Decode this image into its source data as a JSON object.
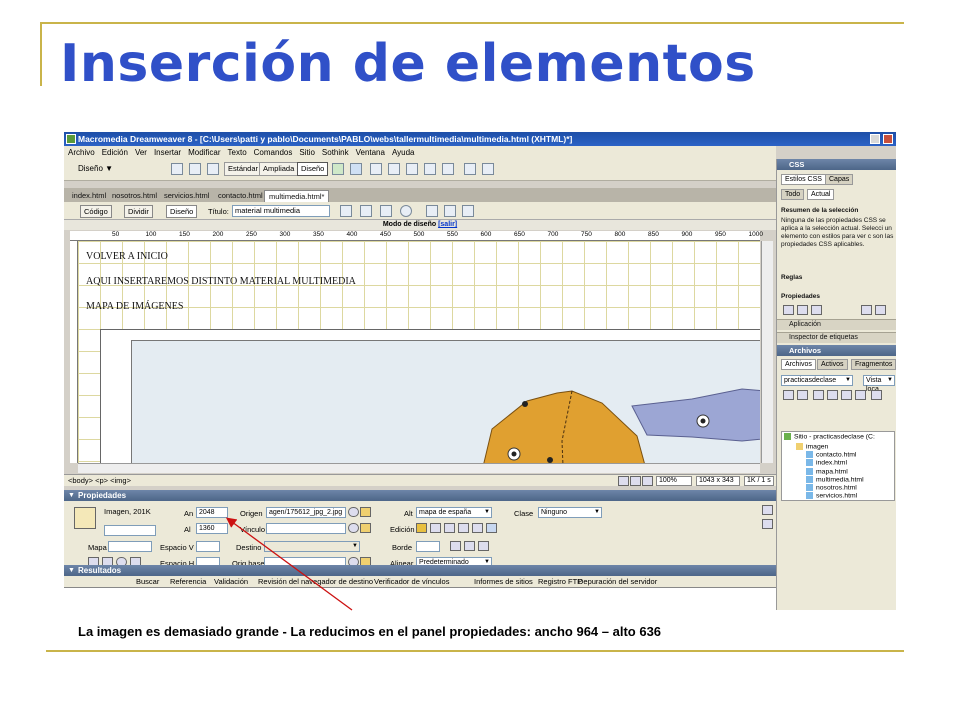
{
  "slide": {
    "title": "Inserción de elementos",
    "caption": "La imagen es demasiado grande - La reducimos en el panel propiedades: ancho 964 – alto 636"
  },
  "window": {
    "title": "Macromedia Dreamweaver 8 - [C:\\Users\\patti y pablo\\Documents\\PABLO\\webs\\tallermultimedia\\multimedia.html (XHTML)*]"
  },
  "menu": [
    "Archivo",
    "Edición",
    "Ver",
    "Insertar",
    "Modificar",
    "Texto",
    "Comandos",
    "Sitio",
    "Sothink",
    "Ventana",
    "Ayuda"
  ],
  "toolbar": {
    "view_select": "Diseño ▼",
    "btn_estandar": "Estándar",
    "btn_ampliada": "Ampliada",
    "btn_diseno": "Diseño"
  },
  "doc_tabs": [
    "index.html",
    "nosotros.html",
    "servicios.html",
    "contacto.html",
    "multimedia.html*"
  ],
  "doc_toolbar": {
    "codigo": "Código",
    "dividir": "Dividir",
    "diseno": "Diseño",
    "titulo_label": "Título:",
    "titulo_value": "material multimedia"
  },
  "design_mode": {
    "text": "Modo de diseño",
    "link": "[salir]"
  },
  "ruler_marks": [
    "50",
    "100",
    "150",
    "200",
    "250",
    "300",
    "350",
    "400",
    "450",
    "500",
    "550",
    "600",
    "650",
    "700",
    "750",
    "800",
    "850",
    "900",
    "950",
    "1000"
  ],
  "canvas": {
    "line1": "VOLVER A INICIO",
    "line2": "AQUI INSERTAREMOS DISTINTO MATERIAL MULTIMEDIA",
    "line3": "MAPA DE IMÁGENES"
  },
  "status": {
    "tags": "<body> <p> <img>",
    "zoom": "100%",
    "size": "1043 x 343",
    "weight": "1K / 1 s"
  },
  "properties": {
    "header": "Propiedades",
    "image_label": "Imagen, 201K",
    "an_label": "An",
    "an_value": "2048",
    "al_label": "Al",
    "al_value": "1360",
    "origen_label": "Origen",
    "origen_value": "agen/175612_jpg_2.jpg",
    "vinculo_label": "Vínculo",
    "alt_label": "Alt",
    "alt_value": "mapa de españa",
    "clase_label": "Clase",
    "clase_value": "Ninguno",
    "edicion_label": "Edición",
    "mapa_label": "Mapa",
    "espacio_v_label": "Espacio V",
    "destino_label": "Destino",
    "borde_label": "Borde",
    "espacio_h_label": "Espacio H",
    "orig_base_label": "Orig base",
    "alinear_label": "Alinear",
    "alinear_value": "Predeterminado"
  },
  "results": {
    "header": "Resultados",
    "tabs": [
      "Buscar",
      "Referencia",
      "Validación",
      "Revisión del navegador de destino",
      "Verificador de vínculos",
      "Informes de sitios",
      "Registro FTP",
      "Depuración del servidor"
    ]
  },
  "css_panel": {
    "header": "CSS",
    "tab1": "Estilos CSS",
    "tab2": "Capas",
    "sub1": "Todo",
    "sub2": "Actual",
    "summary_title": "Resumen de la selección",
    "summary_text": "Ninguna de las propiedades CSS se aplica a la selección actual. Selecci un elemento con estilos para ver c son las propiedades CSS aplicables.",
    "reglas": "Reglas",
    "propiedades": "Propiedades"
  },
  "aplicacion": "Aplicación",
  "inspector": "Inspector de etiquetas",
  "archivos_panel": {
    "header": "Archivos",
    "tabs": [
      "Archivos",
      "Activos",
      "Fragmentos"
    ],
    "site_select": "practicasdeclase",
    "view_select": "Vista loca",
    "tree_root": "Sitio - practicasdeclase (C:",
    "items": [
      "imagen",
      "contacto.html",
      "index.html",
      "mapa.html",
      "multimedia.html",
      "nosotros.html",
      "servicios.html"
    ]
  }
}
